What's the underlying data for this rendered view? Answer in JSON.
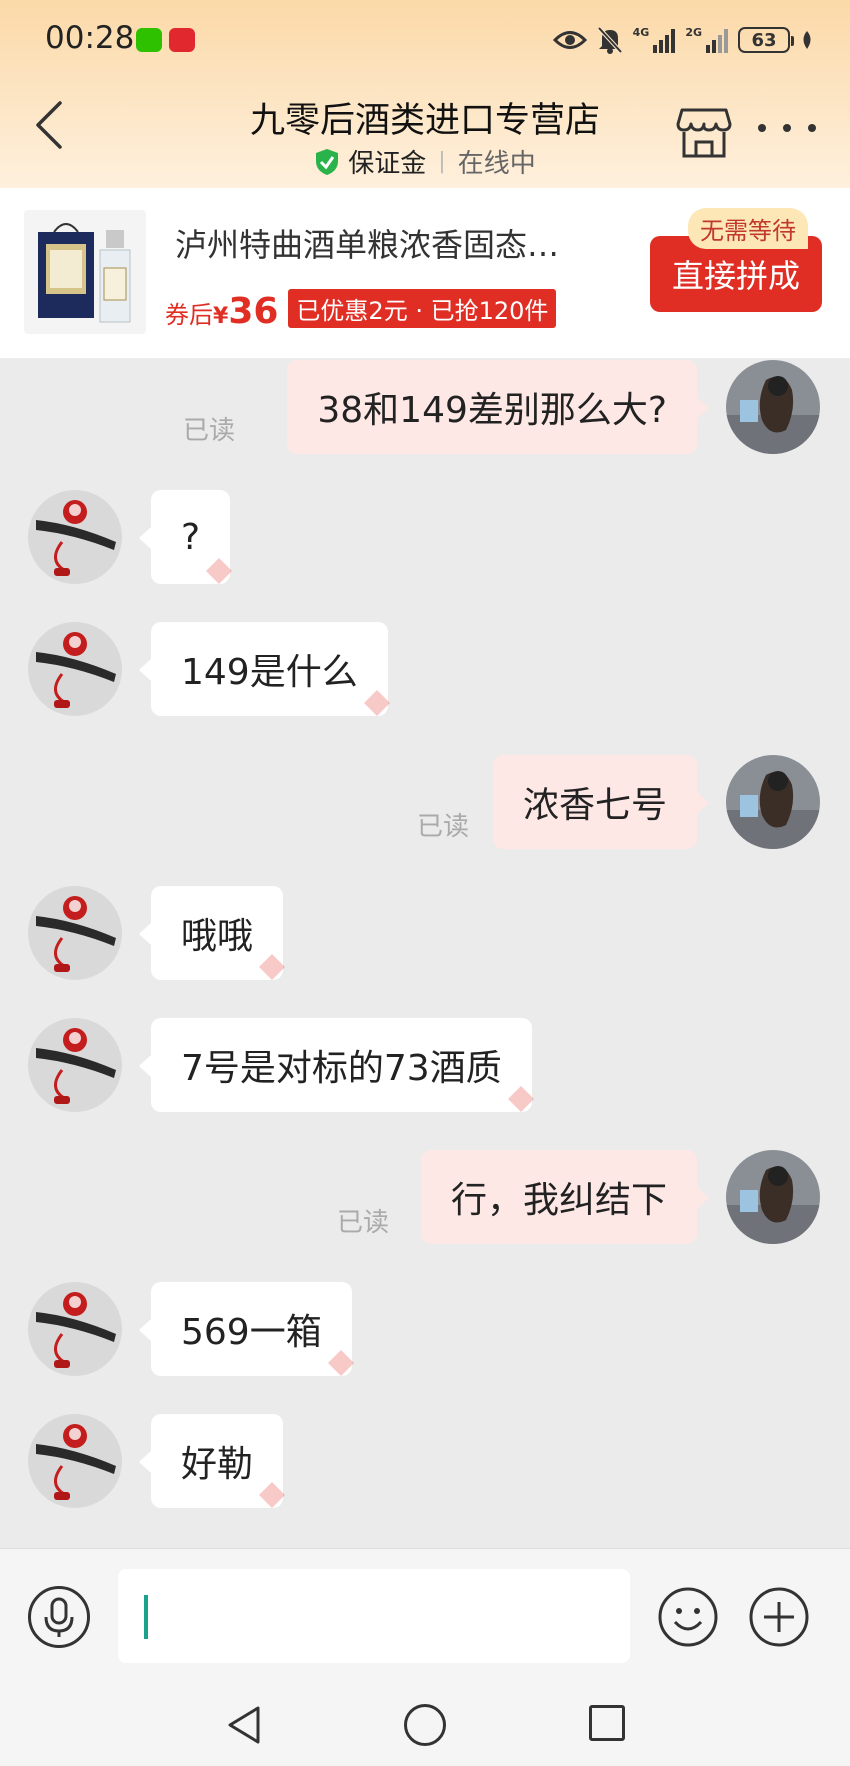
{
  "status_bar": {
    "time": "00:28",
    "signal_1": "4G",
    "signal_2": "2G",
    "battery": "63"
  },
  "header": {
    "title": "九零后酒类进口专营店",
    "badge": "保证金",
    "status": "在线中"
  },
  "product": {
    "name": "泸州特曲酒单粮浓香固态…",
    "price_label": "券后",
    "currency": "¥",
    "price": "36",
    "promo": "已优惠2元 · 已抢120件",
    "tag": "无需等待",
    "buy_button": "直接拼成"
  },
  "messages": [
    {
      "from": "me",
      "text": "38和149差别那么大?",
      "read": "已读"
    },
    {
      "from": "shop",
      "text": "?"
    },
    {
      "from": "shop",
      "text": "149是什么"
    },
    {
      "from": "me",
      "text": "浓香七号",
      "read": "已读"
    },
    {
      "from": "shop",
      "text": "哦哦"
    },
    {
      "from": "shop",
      "text": "7号是对标的73酒质"
    },
    {
      "from": "me",
      "text": "行，我纠结下",
      "read": "已读"
    },
    {
      "from": "shop",
      "text": "569一箱"
    },
    {
      "from": "shop",
      "text": "好勒"
    }
  ],
  "colors": {
    "accent_red": "#e02e24",
    "outgoing_bubble": "#fde8e6",
    "chat_bg": "#ebebeb",
    "verified_green": "#2ab24b",
    "caret": "#1aa28d"
  },
  "icons": [
    "back-icon",
    "shield-check-icon",
    "store-icon",
    "more-icon",
    "mic-icon",
    "emoji-icon",
    "plus-icon",
    "nav-back-icon",
    "nav-home-icon",
    "nav-recents-icon"
  ]
}
